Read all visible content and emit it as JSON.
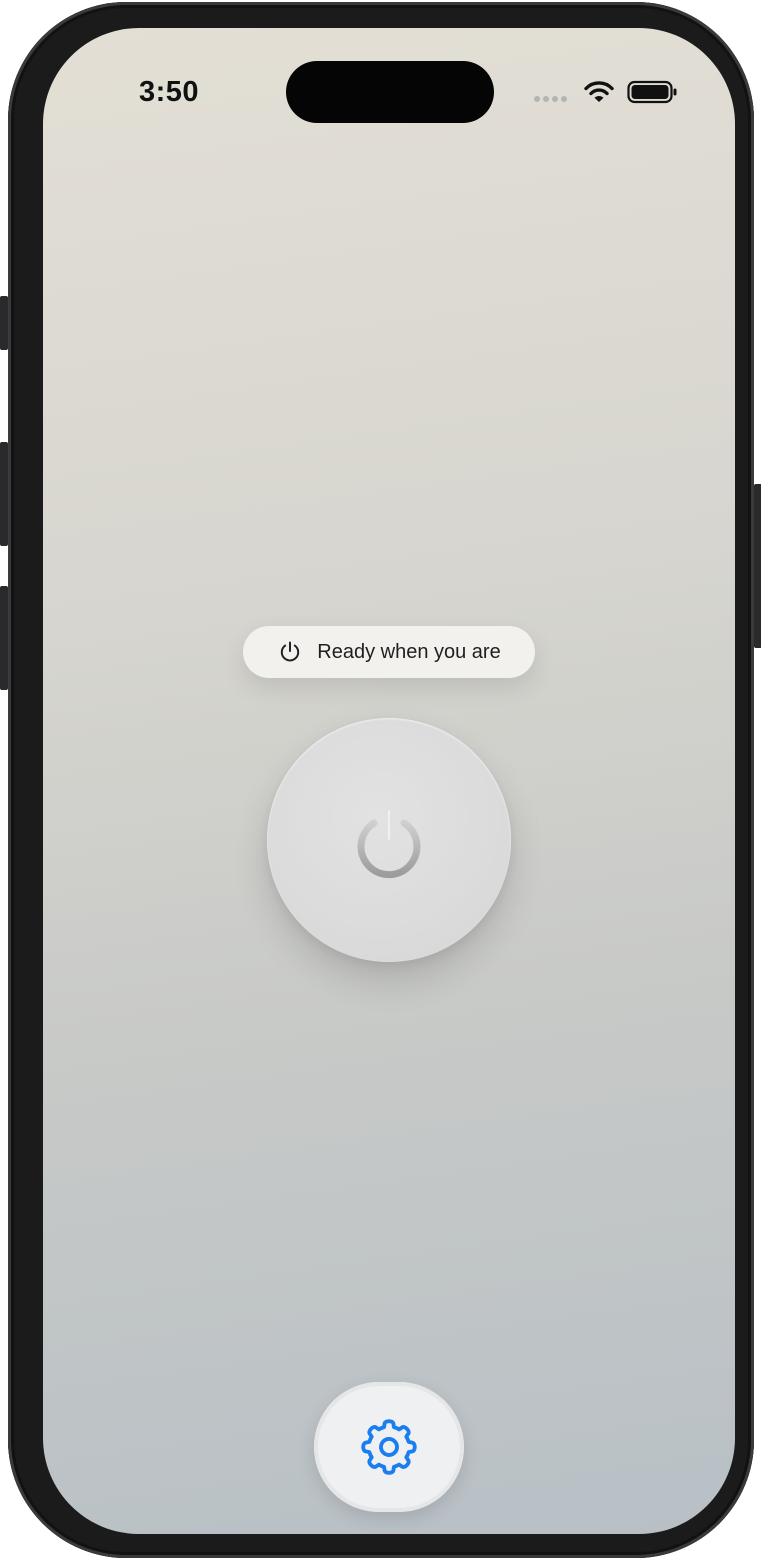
{
  "status_bar": {
    "time": "3:50",
    "icons": [
      "signal-dots-icon",
      "wifi-icon",
      "battery-icon"
    ]
  },
  "status_pill": {
    "icon": "power-icon",
    "text": "Ready when you are"
  },
  "power_button": {
    "icon": "power-icon"
  },
  "settings_button": {
    "icon": "gear-icon",
    "color": "#1a7ef0"
  },
  "colors": {
    "accent": "#1a7ef0",
    "background_top": "#e3dfd5",
    "background_bottom": "#b8c0c6"
  }
}
